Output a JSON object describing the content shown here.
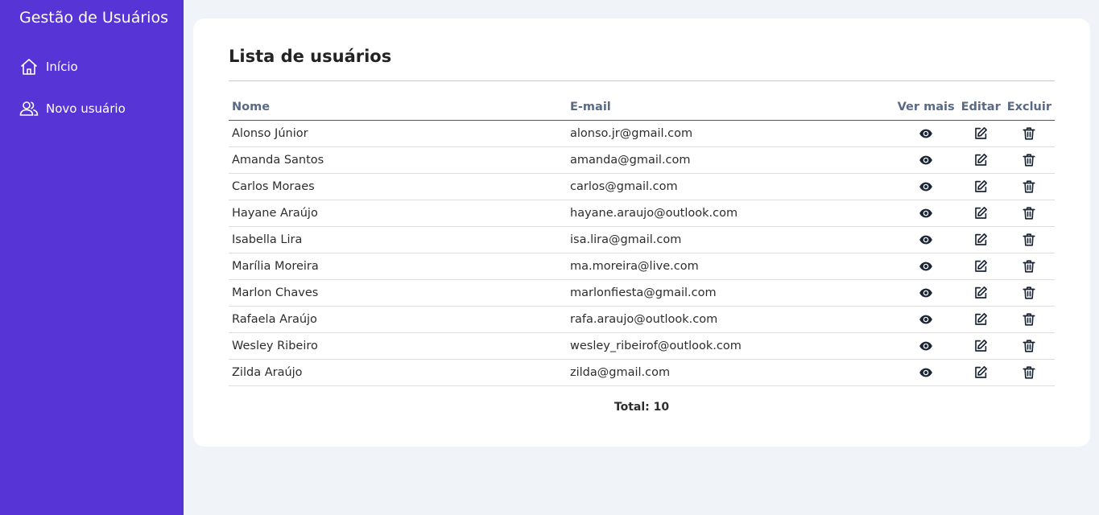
{
  "sidebar": {
    "title": "Gestão de Usuários",
    "items": [
      {
        "label": "Início",
        "icon": "home-icon"
      },
      {
        "label": "Novo usuário",
        "icon": "users-icon"
      }
    ]
  },
  "main": {
    "title": "Lista de usuários",
    "columns": {
      "name": "Nome",
      "email": "E-mail",
      "view": "Ver mais",
      "edit": "Editar",
      "delete": "Excluir"
    },
    "users": [
      {
        "name": "Alonso Júnior",
        "email": "alonso.jr@gmail.com"
      },
      {
        "name": "Amanda Santos",
        "email": "amanda@gmail.com"
      },
      {
        "name": "Carlos Moraes",
        "email": "carlos@gmail.com"
      },
      {
        "name": "Hayane Araújo",
        "email": "hayane.araujo@outlook.com"
      },
      {
        "name": "Isabella Lira",
        "email": "isa.lira@gmail.com"
      },
      {
        "name": "Marília Moreira",
        "email": "ma.moreira@live.com"
      },
      {
        "name": "Marlon Chaves",
        "email": "marlonfiesta@gmail.com"
      },
      {
        "name": "Rafaela Araújo",
        "email": "rafa.araujo@outlook.com"
      },
      {
        "name": "Wesley Ribeiro",
        "email": "wesley_ribeirof@outlook.com"
      },
      {
        "name": "Zilda Araújo",
        "email": "zilda@gmail.com"
      }
    ],
    "total": "Total: 10"
  },
  "colors": {
    "sidebar": "#5634d5",
    "background": "#f0f3f8",
    "header_text": "#5a6a86",
    "icon": "#1b2535"
  }
}
